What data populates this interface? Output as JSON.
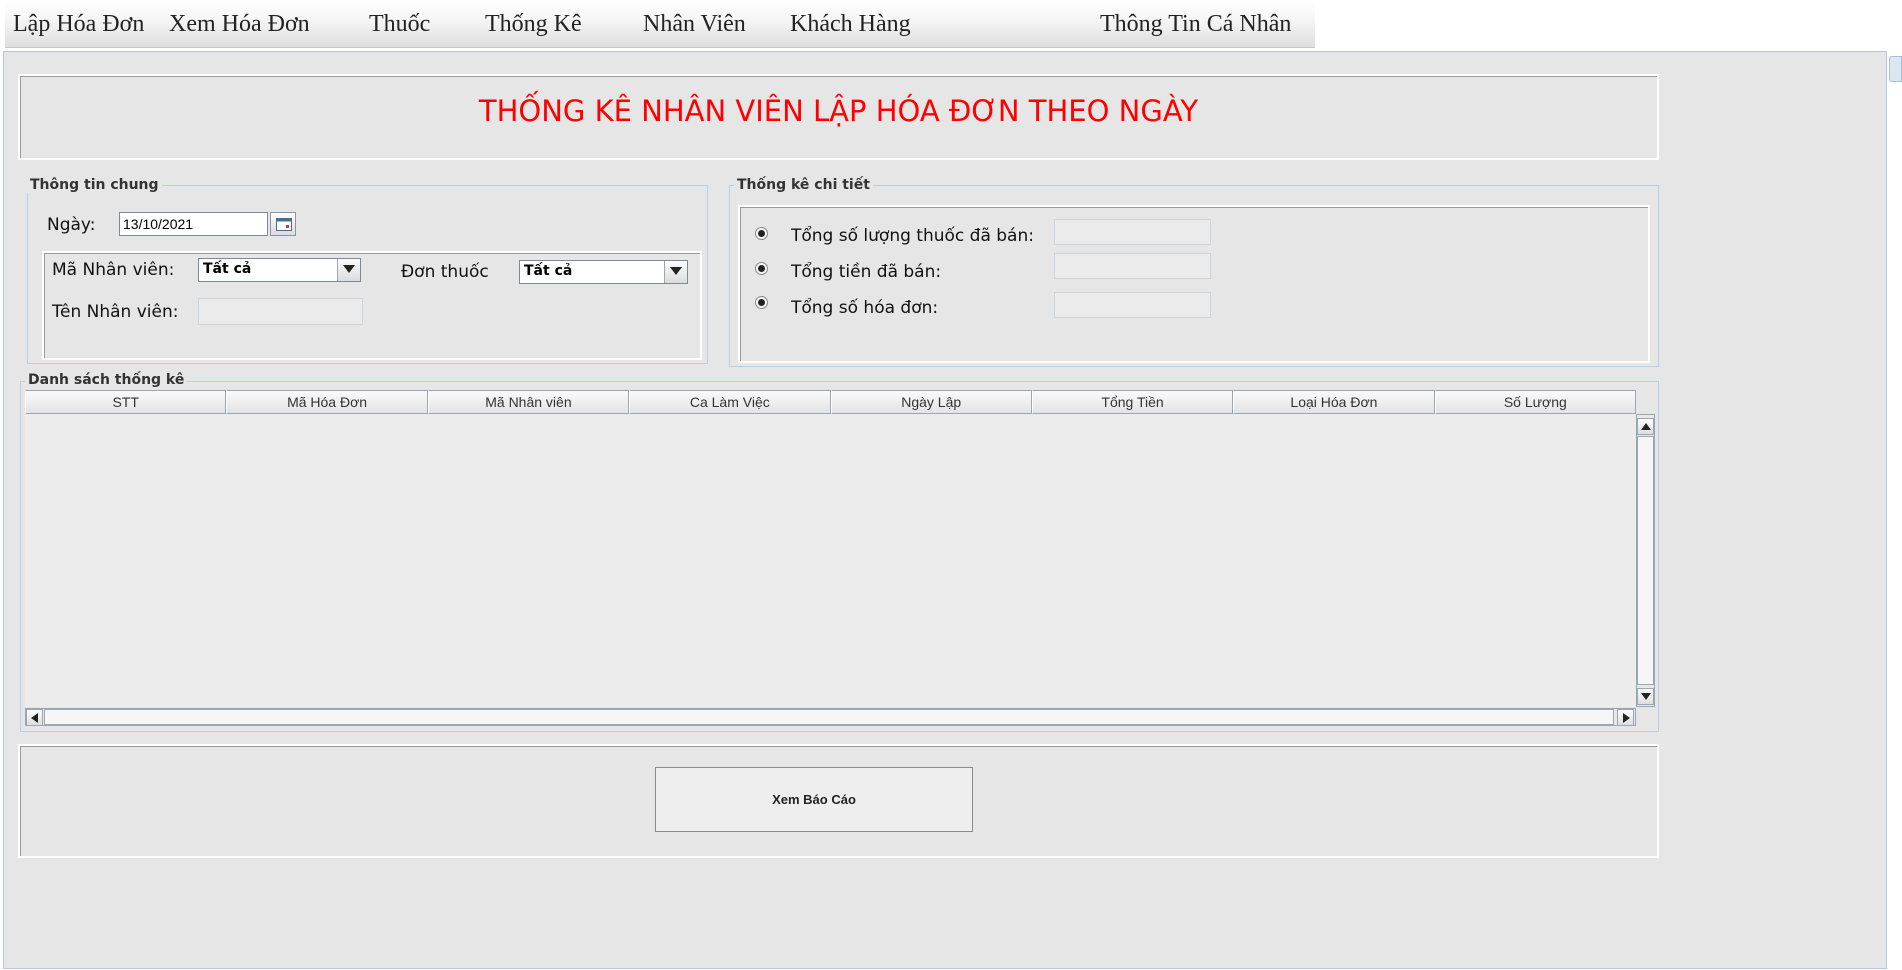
{
  "menu": {
    "items": [
      {
        "label": "Lập Hóa Đơn"
      },
      {
        "label": "Xem Hóa Đơn"
      },
      {
        "label": "Thuốc"
      },
      {
        "label": "Thống Kê"
      },
      {
        "label": "Nhân Viên"
      },
      {
        "label": "Khách Hàng"
      },
      {
        "label": "Thông Tin Cá Nhân"
      }
    ]
  },
  "header": {
    "title": "THỐNG KÊ NHÂN VIÊN LẬP HÓA ĐƠN THEO NGÀY",
    "title_color": "#ff0000"
  },
  "general_info": {
    "group_title": "Thông tin chung",
    "date_label": "Ngày:",
    "date_value": "13/10/2021",
    "employee_id_label": "Mã Nhân viên:",
    "employee_id_value": "Tất cả",
    "order_label": "Đơn thuốc",
    "order_value": "Tất cả",
    "employee_name_label": "Tên Nhân viên:",
    "employee_name_value": ""
  },
  "detail_stats": {
    "group_title": "Thống kê chi tiết",
    "items": [
      {
        "label": "Tổng số lượng thuốc đã bán:",
        "value": ""
      },
      {
        "label": "Tổng tiền đã bán:",
        "value": ""
      },
      {
        "label": "Tổng số hóa đơn:",
        "value": ""
      }
    ]
  },
  "stats_table": {
    "group_title": "Danh sách thống kê",
    "columns": [
      "STT",
      "Mã Hóa Đơn",
      "Mã Nhân viên",
      "Ca Làm Việc",
      "Ngày Lập",
      "Tổng Tiền",
      "Loại Hóa Đơn",
      "Số Lượng"
    ],
    "rows": []
  },
  "actions": {
    "report_button": "Xem Báo Cáo"
  },
  "icons": {
    "calendar": "calendar-icon",
    "dropdown": "chevron-down-icon",
    "scroll_up": "arrow-up-icon",
    "scroll_down": "arrow-down-icon",
    "scroll_left": "arrow-left-icon",
    "scroll_right": "arrow-right-icon"
  }
}
